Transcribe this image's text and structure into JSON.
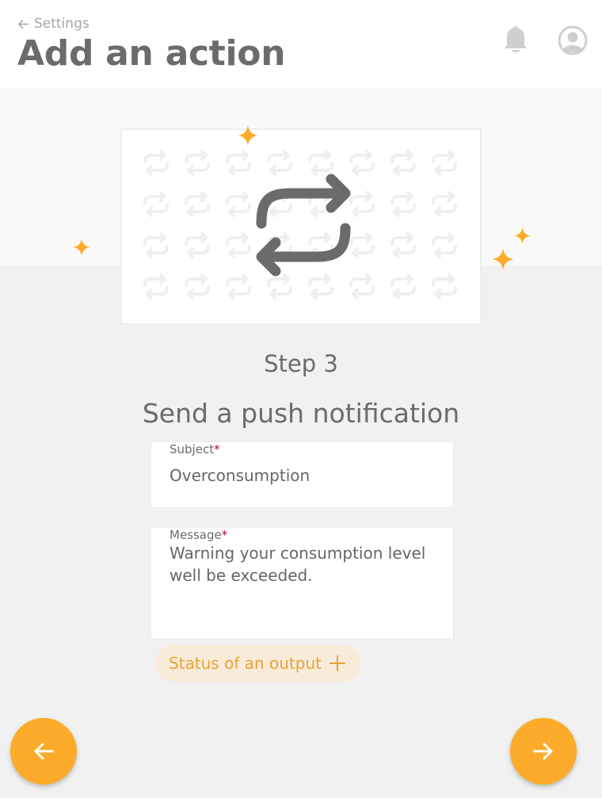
{
  "header": {
    "back_label": "Settings",
    "title": "Add an action"
  },
  "step": {
    "label": "Step 3",
    "title": "Send a push notification"
  },
  "form": {
    "subject": {
      "label": "Subject",
      "required_mark": "*",
      "value": "Overconsumption"
    },
    "message": {
      "label": "Message",
      "required_mark": "*",
      "line1": "Warning your consumption level",
      "line2": "well be exceeded."
    }
  },
  "status_chip": {
    "label": "Status of an output"
  },
  "colors": {
    "accent": "#fcac2a",
    "chip_bg": "#f8ebd9",
    "chip_text": "#e8a237",
    "required": "#b01030"
  },
  "icons": [
    "arrow-left-icon",
    "bell-icon",
    "user-avatar-icon",
    "repeat-icon",
    "sparkle-icon",
    "plus-icon",
    "arrow-right-icon"
  ]
}
